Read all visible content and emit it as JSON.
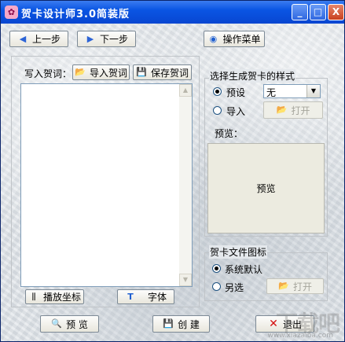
{
  "window": {
    "title": "贺卡设计师3.0简装版",
    "icon_glyph": "✿",
    "controls": {
      "minimize": "_",
      "maximize": "□",
      "close": "X"
    }
  },
  "toolbar": {
    "prev_label": "上一步",
    "next_label": "下一步",
    "menu_label": "操作菜单"
  },
  "greeting": {
    "label": "写入贺词：",
    "import_label": "导入贺词",
    "save_label": "保存贺词",
    "text": ""
  },
  "style_group": {
    "title": "选择生成贺卡的样式",
    "preset_label": "预设",
    "preset_value": "无",
    "import_label": "导入",
    "open_label": "打开",
    "preview_label": "预览：",
    "preview_text": "预览"
  },
  "icon_group": {
    "title": "贺卡文件图标",
    "default_label": "系统默认",
    "other_label": "另选",
    "open_label": "打开"
  },
  "bottom_tools": {
    "coords_label": "播放坐标",
    "font_label": "字体"
  },
  "actions": {
    "preview_label": "预  览",
    "create_label": "创  建",
    "exit_label": "退出"
  },
  "watermark": {
    "text": "下载吧",
    "site": "www.xiazaiba.com"
  },
  "colors": {
    "titlebar": "#0a55e3",
    "accent_arrow": "#2d64d6",
    "exit_x": "#d41010"
  }
}
